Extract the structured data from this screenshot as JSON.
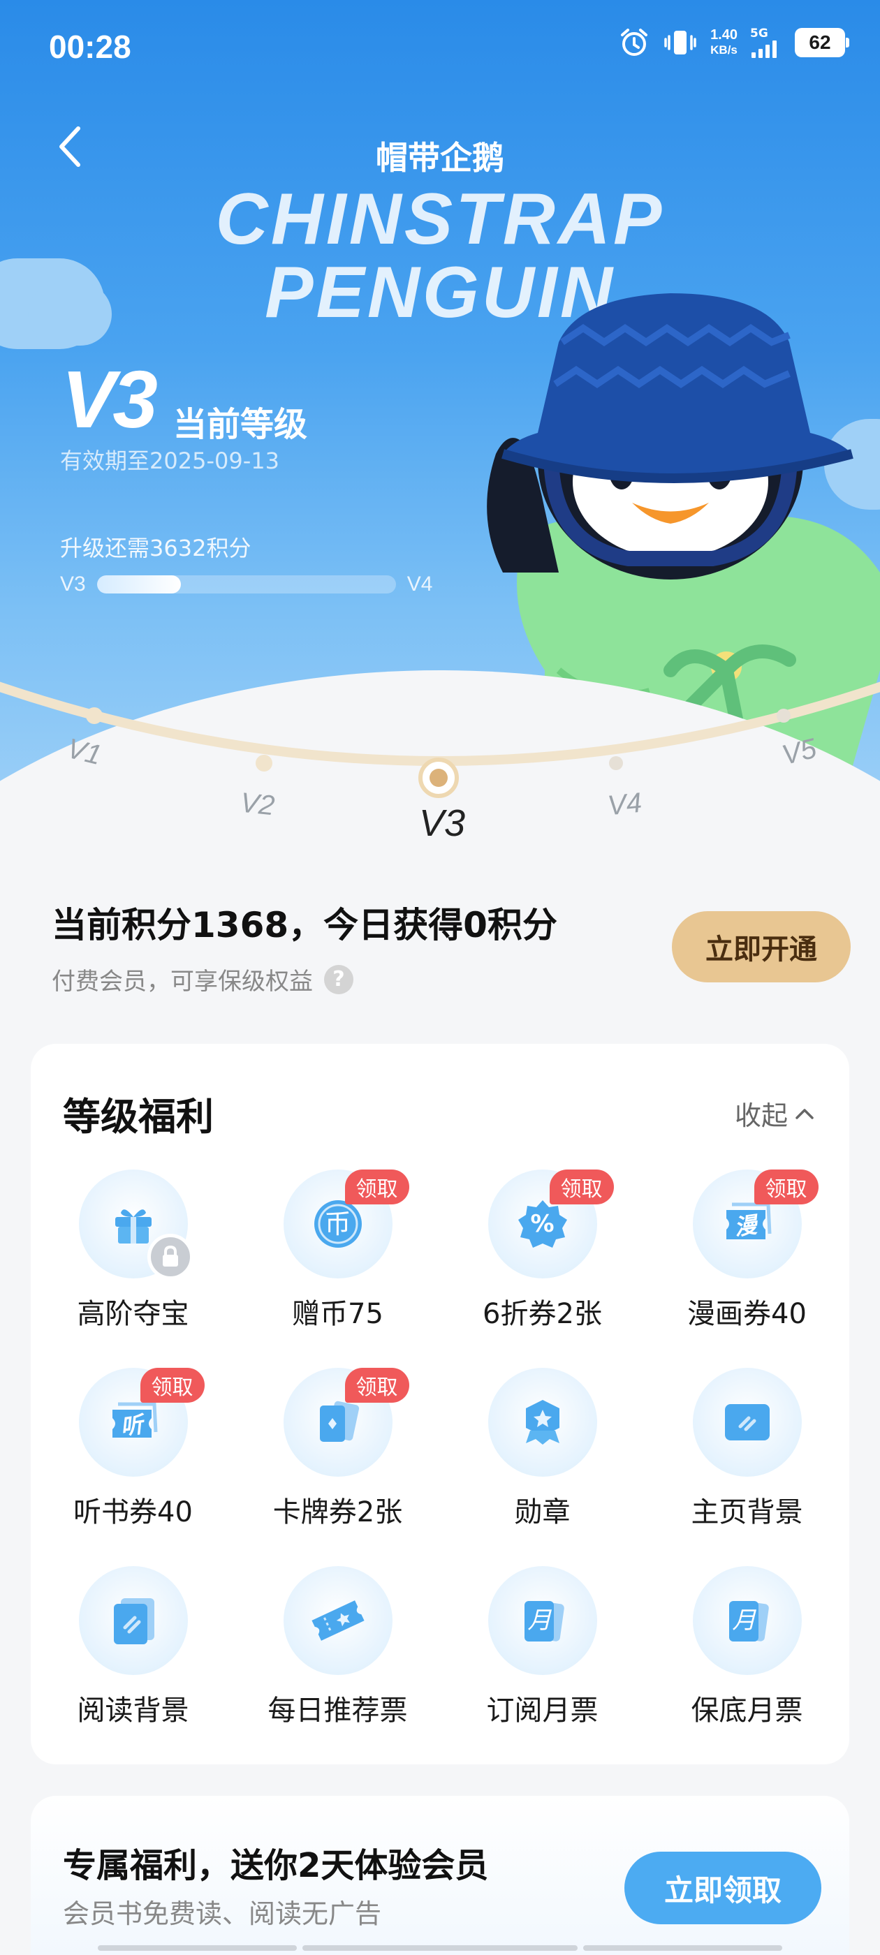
{
  "status_bar": {
    "time": "00:28",
    "net_speed": "1.40",
    "net_unit": "KB/s",
    "signal_label": "5G",
    "battery": "62"
  },
  "hero": {
    "title_cn": "帽带企鹅",
    "title_en_line1": "CHINSTRAP",
    "title_en_line2": "PENGUIN",
    "level": "V3",
    "level_label": "当前等级",
    "valid_until": "有效期至2025-09-13",
    "upgrade_need": "升级还需3632积分",
    "progress_from": "V3",
    "progress_to": "V4",
    "progress_fraction": 0.28,
    "levels": [
      "V1",
      "V2",
      "V3",
      "V4",
      "V5"
    ],
    "current_level_index": 2
  },
  "points": {
    "title": "当前积分1368，今日获得0积分",
    "subtitle": "付费会员，可享保级权益",
    "help_symbol": "?",
    "open_button": "立即开通"
  },
  "benefits": {
    "title": "等级福利",
    "collapse_label": "收起",
    "claim_label": "领取",
    "items": [
      {
        "label": "高阶夺宝",
        "icon": "gift-icon",
        "claimable": false,
        "locked": true,
        "glyph": ""
      },
      {
        "label": "赠币75",
        "icon": "coin-icon",
        "claimable": true,
        "locked": false,
        "glyph": "币"
      },
      {
        "label": "6折券2张",
        "icon": "discount-icon",
        "claimable": true,
        "locked": false,
        "glyph": "%"
      },
      {
        "label": "漫画券40",
        "icon": "comic-ticket-icon",
        "claimable": true,
        "locked": false,
        "glyph": "漫"
      },
      {
        "label": "听书券40",
        "icon": "audio-ticket-icon",
        "claimable": true,
        "locked": false,
        "glyph": "听"
      },
      {
        "label": "卡牌券2张",
        "icon": "card-ticket-icon",
        "claimable": true,
        "locked": false,
        "glyph": ""
      },
      {
        "label": "勋章",
        "icon": "medal-icon",
        "claimable": false,
        "locked": false,
        "glyph": ""
      },
      {
        "label": "主页背景",
        "icon": "homepage-bg-icon",
        "claimable": false,
        "locked": false,
        "glyph": ""
      },
      {
        "label": "阅读背景",
        "icon": "reading-bg-icon",
        "claimable": false,
        "locked": false,
        "glyph": ""
      },
      {
        "label": "每日推荐票",
        "icon": "recommend-ticket-icon",
        "claimable": false,
        "locked": false,
        "glyph": ""
      },
      {
        "label": "订阅月票",
        "icon": "subscribe-monthly-ticket-icon",
        "claimable": false,
        "locked": false,
        "glyph": "月"
      },
      {
        "label": "保底月票",
        "icon": "guaranteed-monthly-ticket-icon",
        "claimable": false,
        "locked": false,
        "glyph": "月"
      }
    ]
  },
  "promo": {
    "title": "专属福利，送你2天体验会员",
    "subtitle": "会员书免费读、阅读无广告",
    "button": "立即领取"
  },
  "colors": {
    "hero_blue": "#2a8be8",
    "accent_blue": "#4cabf2",
    "claim_red": "#f0595a",
    "gold_button": "#e8c692"
  }
}
